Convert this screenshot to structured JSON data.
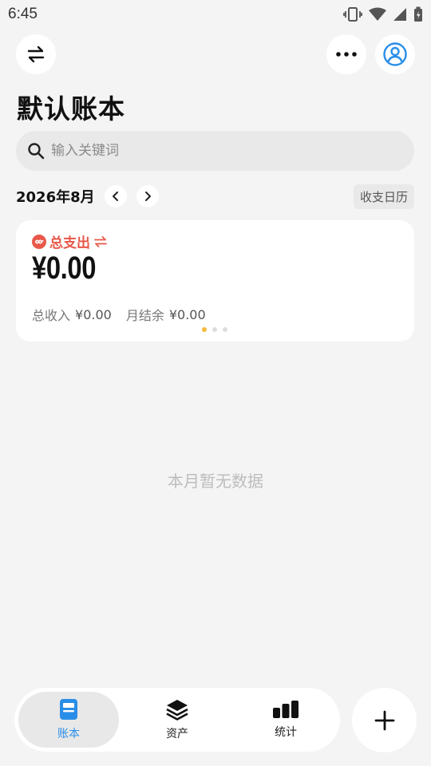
{
  "status_bar": {
    "time": "6:45"
  },
  "header": {
    "title": "默认账本"
  },
  "search": {
    "placeholder": "输入关键词"
  },
  "month": {
    "label": "2026年8月",
    "calendar_button": "收支日历"
  },
  "summary": {
    "label": "总支出",
    "amount": "¥0.00",
    "income_label": "总收入",
    "income_value": "¥0.00",
    "balance_label": "月结余",
    "balance_value": "¥0.00",
    "accent_color": "#e8584a",
    "page_count": 3,
    "active_page": 1
  },
  "empty_state": {
    "message": "本月暂无数据"
  },
  "bottom_nav": {
    "items": [
      {
        "label": "账本",
        "icon": "ledger-icon",
        "active": true
      },
      {
        "label": "资产",
        "icon": "layers-icon",
        "active": false
      },
      {
        "label": "统计",
        "icon": "bar-chart-icon",
        "active": false
      }
    ],
    "active_color": "#2a8ee8"
  },
  "fab": {
    "icon": "plus-icon"
  }
}
